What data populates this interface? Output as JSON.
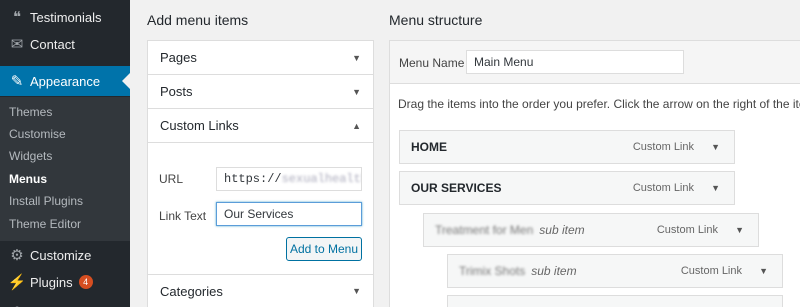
{
  "sidebar": {
    "items": [
      {
        "label": "Testimonials",
        "icon": "quote-icon"
      },
      {
        "label": "Contact",
        "icon": "mail-icon"
      },
      {
        "label": "Appearance",
        "icon": "paintbrush-icon"
      }
    ],
    "submenu": [
      "Themes",
      "Customise",
      "Widgets",
      "Menus",
      "Install Plugins",
      "Theme Editor"
    ],
    "customize_label": "Customize",
    "plugins_label": "Plugins",
    "plugins_badge": "4",
    "accent_color": "#0073aa"
  },
  "left": {
    "heading": "Add menu items",
    "sections": [
      "Pages",
      "Posts",
      "Custom Links",
      "Categories"
    ],
    "url_label": "URL",
    "url_value": "https://",
    "url_blurred": "sexualhealthg",
    "link_text_label": "Link Text",
    "link_text_value": "Our Services",
    "add_button": "Add to Menu"
  },
  "right": {
    "heading": "Menu structure",
    "menu_name_label": "Menu Name",
    "menu_name_value": "Main Menu",
    "help_text": "Drag the items into the order you prefer. Click the arrow on the right of the item to rev",
    "items": [
      {
        "title": "HOME",
        "type": "Custom Link"
      },
      {
        "title": "OUR SERVICES",
        "type": "Custom Link"
      },
      {
        "title": "Treatment for Men",
        "sub": "sub item",
        "type": "Custom Link"
      },
      {
        "title": "Trimix Shots",
        "sub": "sub item",
        "type": "Custom Link"
      }
    ]
  }
}
